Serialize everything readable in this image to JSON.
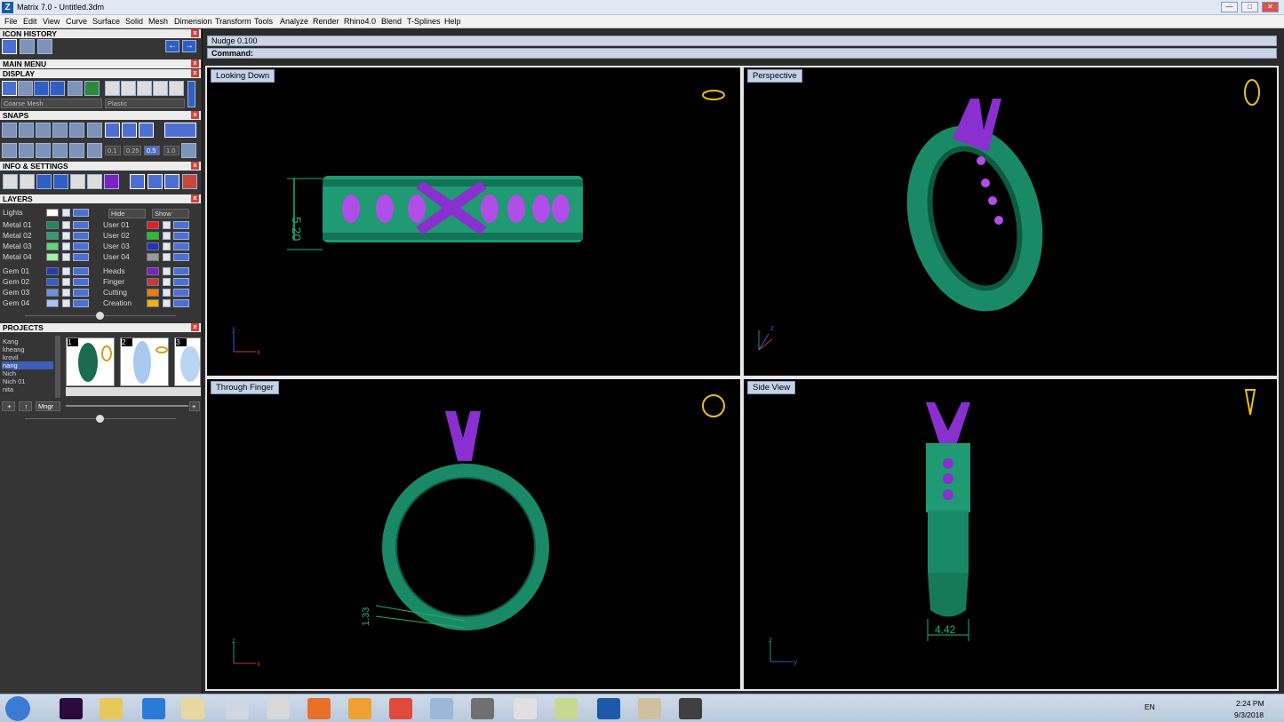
{
  "window": {
    "title": "Matrix 7.0 - Untitled.3dm",
    "app_icon": "Z",
    "minimize": "—",
    "maximize": "□",
    "close": "✕"
  },
  "menu": [
    "File",
    "Edit",
    "View",
    "Curve",
    "Surface",
    "Solid",
    "Mesh",
    "Dimension",
    "Transform",
    "Tools",
    "Analyze",
    "Render",
    "Rhino4.0",
    "Blend",
    "T-Splines",
    "Help"
  ],
  "panels": {
    "icon_history": "ICON HISTORY",
    "main_menu": "MAIN MENU",
    "display": "DISPLAY",
    "display_mode": "Coarse Mesh",
    "material": "Plastic",
    "snaps": "SNAPS",
    "snap_values": [
      "0.1",
      "0.25",
      "0.5",
      "1.0"
    ],
    "info_settings": "INFO & SETTINGS",
    "layers": "LAYERS",
    "lights": "Lights",
    "hide": "Hide",
    "show": "Show",
    "projects": "PROJECTS",
    "mngr": "Mngr",
    "close_glyph": "x"
  },
  "layers_left": [
    {
      "name": "Metal 01",
      "color": "#1e8a5a"
    },
    {
      "name": "Metal 02",
      "color": "#2aa070"
    },
    {
      "name": "Metal 03",
      "color": "#5fd77a"
    },
    {
      "name": "Metal 04",
      "color": "#9ff0a8"
    },
    {
      "name": "Gem 01",
      "color": "#1f3fa8"
    },
    {
      "name": "Gem 02",
      "color": "#2f5ec7"
    },
    {
      "name": "Gem 03",
      "color": "#6b8fe0"
    },
    {
      "name": "Gem 04",
      "color": "#a9c3f5"
    }
  ],
  "layers_right": [
    {
      "name": "User 01",
      "color": "#e02020"
    },
    {
      "name": "User 02",
      "color": "#22c422"
    },
    {
      "name": "User 03",
      "color": "#2230c4"
    },
    {
      "name": "User 04",
      "color": "#9a9a9a"
    },
    {
      "name": "Heads",
      "color": "#7a22c4"
    },
    {
      "name": "Finger",
      "color": "#c43a3a"
    },
    {
      "name": "Cutting",
      "color": "#f07a10"
    },
    {
      "name": "Creation",
      "color": "#f0b010"
    }
  ],
  "projects": [
    "Kang",
    "kheang",
    "krovil",
    "nang",
    "Nich",
    "Nich 01",
    "nita"
  ],
  "selected_project": "nang",
  "thumb_numbers": [
    "1",
    "2",
    "3"
  ],
  "nudge": "Nudge 0.100",
  "command": "Command:",
  "viewports": {
    "top_left": "Looking Down",
    "top_right": "Perspective",
    "bottom_left": "Through Finger",
    "bottom_right": "Side View"
  },
  "dimensions": {
    "looking_down": "5.20",
    "through_finger": "1.33",
    "side_view": "4.42"
  },
  "axes": {
    "x": "x",
    "y": "y",
    "z": "z"
  },
  "colors": {
    "metal": "#1f9a72",
    "metal_dark": "#0e5a40",
    "heads": "#8a2fd0",
    "dimension": "#1fb078",
    "gold": "#e8c020"
  },
  "taskbar": {
    "language": "EN",
    "time": "2:24 PM",
    "date": "9/3/2018"
  },
  "taskbar_icons": [
    "start-orb-icon",
    "premiere-icon",
    "folder-icon",
    "ie-icon",
    "explorer-icon",
    "calculator-icon",
    "snipping-icon",
    "firefox-icon",
    "media-player-icon",
    "chrome-icon",
    "3d-app-icon",
    "tool-icon",
    "zbrush-icon",
    "notes-icon",
    "matrix-icon",
    "paint-icon",
    "app-icon"
  ]
}
